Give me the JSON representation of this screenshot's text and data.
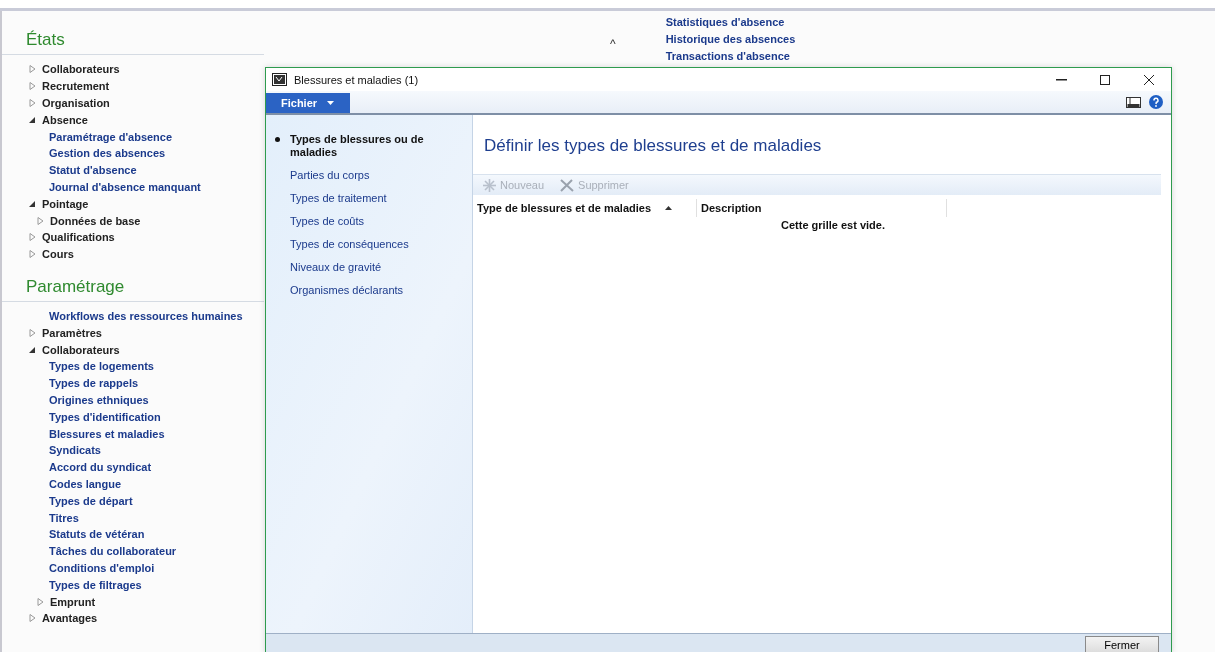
{
  "background": {
    "collapse_glyph": "^",
    "related_links": [
      "Statistiques d'absence",
      "Historique des absences",
      "Transactions d'absence"
    ],
    "sections": [
      {
        "title": "États",
        "items": [
          {
            "kind": "group",
            "label": "Collaborateurs",
            "expanded": false
          },
          {
            "kind": "group",
            "label": "Recrutement",
            "expanded": false
          },
          {
            "kind": "group",
            "label": "Organisation",
            "expanded": false
          },
          {
            "kind": "group",
            "label": "Absence",
            "expanded": true,
            "children": [
              {
                "kind": "link",
                "label": "Paramétrage d'absence"
              },
              {
                "kind": "link",
                "label": "Gestion des absences"
              },
              {
                "kind": "link",
                "label": "Statut d'absence"
              },
              {
                "kind": "link",
                "label": "Journal d'absence manquant"
              }
            ]
          },
          {
            "kind": "group",
            "label": "Pointage",
            "expanded": true,
            "children": [
              {
                "kind": "group",
                "label": "Données de base",
                "expanded": false
              }
            ]
          },
          {
            "kind": "group",
            "label": "Qualifications",
            "expanded": false
          },
          {
            "kind": "group",
            "label": "Cours",
            "expanded": false
          }
        ]
      },
      {
        "title": "Paramétrage",
        "items": [
          {
            "kind": "link",
            "label": "Workflows des ressources humaines"
          },
          {
            "kind": "group",
            "label": "Paramètres",
            "expanded": false
          },
          {
            "kind": "group",
            "label": "Collaborateurs",
            "expanded": true,
            "children": [
              {
                "kind": "link",
                "label": "Types de logements"
              },
              {
                "kind": "link",
                "label": "Types de rappels"
              },
              {
                "kind": "link",
                "label": "Origines ethniques"
              },
              {
                "kind": "link",
                "label": "Types d'identification"
              },
              {
                "kind": "link",
                "label": "Blessures et maladies"
              },
              {
                "kind": "link",
                "label": "Syndicats"
              },
              {
                "kind": "link",
                "label": "Accord du syndicat"
              },
              {
                "kind": "link",
                "label": "Codes langue"
              },
              {
                "kind": "link",
                "label": "Types de départ"
              },
              {
                "kind": "link",
                "label": "Titres"
              },
              {
                "kind": "link",
                "label": "Statuts de vétéran"
              },
              {
                "kind": "link",
                "label": "Tâches du collaborateur"
              },
              {
                "kind": "link",
                "label": "Conditions d'emploi"
              },
              {
                "kind": "link",
                "label": "Types de filtrages"
              },
              {
                "kind": "group",
                "label": "Emprunt",
                "expanded": false
              }
            ]
          },
          {
            "kind": "group",
            "label": "Avantages",
            "expanded": false
          }
        ]
      }
    ]
  },
  "dialog": {
    "title": "Blessures et maladies (1)",
    "menu": "Fichier",
    "nav": [
      {
        "label": "Types de blessures ou de maladies",
        "selected": true
      },
      {
        "label": "Parties du corps",
        "selected": false
      },
      {
        "label": "Types de traitement",
        "selected": false
      },
      {
        "label": "Types de coûts",
        "selected": false
      },
      {
        "label": "Types de conséquences",
        "selected": false
      },
      {
        "label": "Niveaux de gravité",
        "selected": false
      },
      {
        "label": "Organismes déclarants",
        "selected": false
      }
    ],
    "heading": "Définir les types de blessures et de maladies",
    "toolbar": [
      {
        "kind": "new",
        "label": "Nouveau",
        "disabled": true
      },
      {
        "kind": "delete",
        "label": "Supprimer",
        "disabled": true
      }
    ],
    "grid": {
      "columns": [
        {
          "label": "Type de blessures et de maladies",
          "sorted": true
        },
        {
          "label": "Description",
          "sorted": false
        }
      ],
      "empty_text": "Cette grille est vide."
    },
    "close_button": "Fermer"
  }
}
